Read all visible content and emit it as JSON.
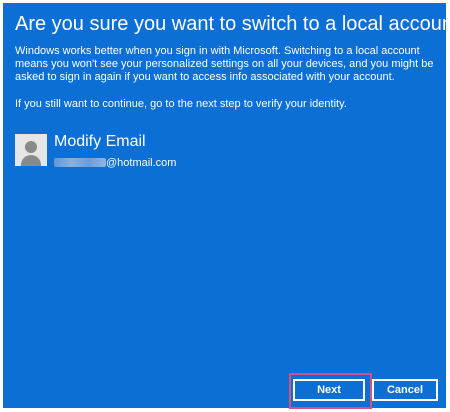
{
  "dialog": {
    "title": "Are you sure you want to switch to a local account?",
    "paragraph1": "Windows works better when you sign in with Microsoft. Switching to a local account means you won't see your personalized settings on all your devices, and you might be asked to sign in again if you want to access info associated with your account.",
    "paragraph2": "If you still want to continue, go to the next step to verify your identity."
  },
  "account": {
    "name": "Modify Email",
    "email_visible_part": "@hotmail.com",
    "avatar_icon": "user-placeholder-icon"
  },
  "buttons": {
    "next_label": "Next",
    "cancel_label": "Cancel"
  },
  "colors": {
    "background": "#0b6fd6",
    "text": "#ffffff",
    "highlight": "#d9507a"
  }
}
